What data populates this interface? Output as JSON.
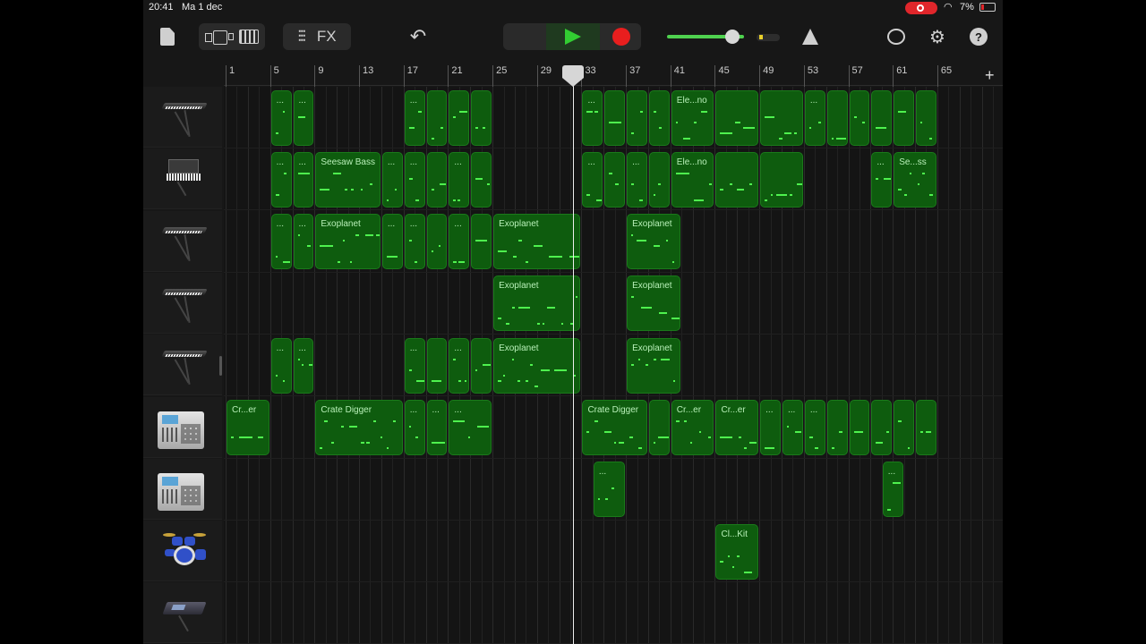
{
  "status": {
    "time": "20:41",
    "date": "Ma 1 dec",
    "battery": "7%"
  },
  "toolbar": {
    "fx_label": "FX",
    "icons": [
      "document-icon",
      "tracks-view-icon",
      "keyboard-view-icon",
      "mixer-icon",
      "undo-icon",
      "stop-icon",
      "play-icon",
      "record-icon",
      "metronome-icon",
      "loop-icon",
      "settings-icon",
      "help-icon"
    ],
    "master_volume": 0.85
  },
  "ruler": {
    "bars": [
      "1",
      "5",
      "9",
      "13",
      "17",
      "21",
      "25",
      "29",
      "33",
      "37",
      "41",
      "45",
      "49",
      "53",
      "57",
      "61",
      "65"
    ]
  },
  "tracks": [
    {
      "instrument": "keyboard",
      "regions": [
        {
          "start": 5,
          "end": 7,
          "name": "..."
        },
        {
          "start": 7,
          "end": 9,
          "name": "..."
        },
        {
          "start": 17,
          "end": 19,
          "name": "..."
        },
        {
          "start": 19,
          "end": 21,
          "name": ""
        },
        {
          "start": 21,
          "end": 23,
          "name": ""
        },
        {
          "start": 23,
          "end": 25,
          "name": ""
        },
        {
          "start": 33,
          "end": 35,
          "name": "..."
        },
        {
          "start": 35,
          "end": 37,
          "name": ""
        },
        {
          "start": 37,
          "end": 39,
          "name": ""
        },
        {
          "start": 39,
          "end": 41,
          "name": ""
        },
        {
          "start": 41,
          "end": 45,
          "name": "Ele...no"
        },
        {
          "start": 45,
          "end": 49,
          "name": ""
        },
        {
          "start": 49,
          "end": 53,
          "name": ""
        },
        {
          "start": 53,
          "end": 55,
          "name": "..."
        },
        {
          "start": 55,
          "end": 57,
          "name": ""
        },
        {
          "start": 57,
          "end": 59,
          "name": ""
        },
        {
          "start": 59,
          "end": 61,
          "name": ""
        },
        {
          "start": 61,
          "end": 63,
          "name": ""
        },
        {
          "start": 63,
          "end": 65,
          "name": ""
        }
      ]
    },
    {
      "instrument": "synth",
      "regions": [
        {
          "start": 5,
          "end": 7,
          "name": "..."
        },
        {
          "start": 7,
          "end": 9,
          "name": "..."
        },
        {
          "start": 9,
          "end": 15,
          "name": "Seesaw Bass"
        },
        {
          "start": 15,
          "end": 17,
          "name": "..."
        },
        {
          "start": 17,
          "end": 19,
          "name": "..."
        },
        {
          "start": 19,
          "end": 21,
          "name": ""
        },
        {
          "start": 21,
          "end": 23,
          "name": "..."
        },
        {
          "start": 23,
          "end": 25,
          "name": ""
        },
        {
          "start": 33,
          "end": 35,
          "name": "..."
        },
        {
          "start": 35,
          "end": 37,
          "name": ""
        },
        {
          "start": 37,
          "end": 39,
          "name": "..."
        },
        {
          "start": 39,
          "end": 41,
          "name": ""
        },
        {
          "start": 41,
          "end": 45,
          "name": "Ele...no"
        },
        {
          "start": 45,
          "end": 49,
          "name": ""
        },
        {
          "start": 49,
          "end": 53,
          "name": ""
        },
        {
          "start": 59,
          "end": 61,
          "name": "..."
        },
        {
          "start": 61,
          "end": 65,
          "name": "Se...ss"
        }
      ]
    },
    {
      "instrument": "keyboard",
      "regions": [
        {
          "start": 5,
          "end": 7,
          "name": "..."
        },
        {
          "start": 7,
          "end": 9,
          "name": "..."
        },
        {
          "start": 9,
          "end": 15,
          "name": "Exoplanet"
        },
        {
          "start": 15,
          "end": 17,
          "name": "..."
        },
        {
          "start": 17,
          "end": 19,
          "name": "..."
        },
        {
          "start": 19,
          "end": 21,
          "name": ""
        },
        {
          "start": 21,
          "end": 23,
          "name": "..."
        },
        {
          "start": 23,
          "end": 25,
          "name": ""
        },
        {
          "start": 25,
          "end": 33,
          "name": "Exoplanet"
        },
        {
          "start": 37,
          "end": 42,
          "name": "Exoplanet"
        }
      ]
    },
    {
      "instrument": "keyboard",
      "regions": [
        {
          "start": 25,
          "end": 33,
          "name": "Exoplanet"
        },
        {
          "start": 37,
          "end": 42,
          "name": "Exoplanet"
        }
      ]
    },
    {
      "instrument": "keyboard",
      "regions": [
        {
          "start": 5,
          "end": 7,
          "name": "..."
        },
        {
          "start": 7,
          "end": 9,
          "name": "..."
        },
        {
          "start": 17,
          "end": 19,
          "name": "..."
        },
        {
          "start": 19,
          "end": 21,
          "name": ""
        },
        {
          "start": 21,
          "end": 23,
          "name": "..."
        },
        {
          "start": 23,
          "end": 25,
          "name": ""
        },
        {
          "start": 25,
          "end": 33,
          "name": "Exoplanet"
        },
        {
          "start": 37,
          "end": 42,
          "name": "Exoplanet"
        }
      ]
    },
    {
      "instrument": "mpc",
      "regions": [
        {
          "start": 1,
          "end": 5,
          "name": "Cr...er"
        },
        {
          "start": 9,
          "end": 17,
          "name": "Crate Digger"
        },
        {
          "start": 17,
          "end": 19,
          "name": "..."
        },
        {
          "start": 19,
          "end": 21,
          "name": "..."
        },
        {
          "start": 21,
          "end": 25,
          "name": "..."
        },
        {
          "start": 33,
          "end": 39,
          "name": "Crate Digger"
        },
        {
          "start": 39,
          "end": 41,
          "name": ""
        },
        {
          "start": 41,
          "end": 45,
          "name": "Cr...er"
        },
        {
          "start": 45,
          "end": 49,
          "name": "Cr...er"
        },
        {
          "start": 49,
          "end": 51,
          "name": "..."
        },
        {
          "start": 51,
          "end": 53,
          "name": "..."
        },
        {
          "start": 53,
          "end": 55,
          "name": "..."
        },
        {
          "start": 55,
          "end": 57,
          "name": ""
        },
        {
          "start": 57,
          "end": 59,
          "name": ""
        },
        {
          "start": 59,
          "end": 61,
          "name": ""
        },
        {
          "start": 61,
          "end": 63,
          "name": ""
        },
        {
          "start": 63,
          "end": 65,
          "name": ""
        }
      ]
    },
    {
      "instrument": "mpc",
      "regions": [
        {
          "start": 34,
          "end": 37,
          "name": "..."
        },
        {
          "start": 60,
          "end": 62,
          "name": "..."
        }
      ]
    },
    {
      "instrument": "drums",
      "regions": [
        {
          "start": 45,
          "end": 49,
          "name": "Cl...Kit"
        }
      ]
    },
    {
      "instrument": "sampler",
      "regions": []
    }
  ],
  "colors": {
    "region_fill": "#0e5c0e",
    "note": "#4ef24e",
    "accent_play": "#32cd32",
    "record": "#e81e1e"
  },
  "playhead_bar": 32.2
}
